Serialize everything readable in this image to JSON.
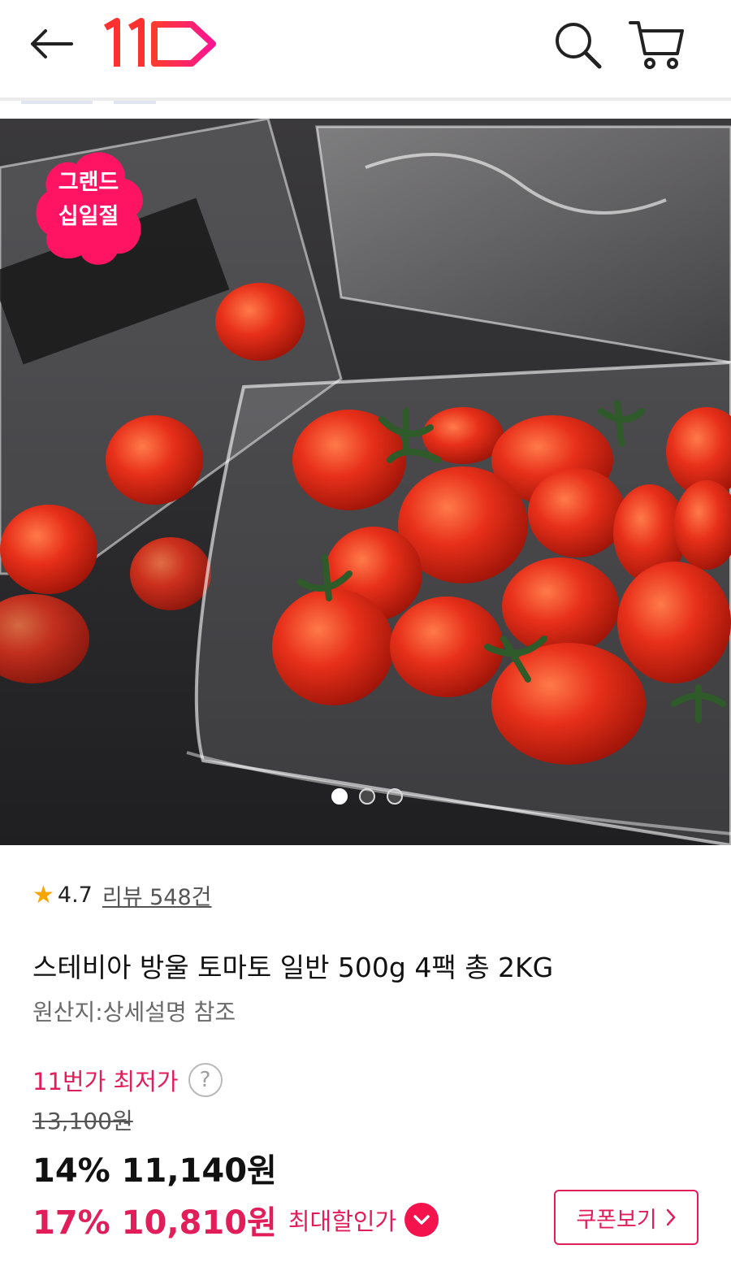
{
  "header": {
    "logo_text": "11",
    "icons": {
      "back": "back-arrow-icon",
      "search": "search-icon",
      "cart": "cart-icon"
    },
    "brand_color": "#ff1f4f"
  },
  "hero": {
    "badge_line1": "그랜드",
    "badge_line2": "십일절",
    "image_description": "product-photo-cherry-tomatoes-in-clear-plastic-packs",
    "slide_count": 3,
    "active_slide": 1
  },
  "product": {
    "rating": "4.7",
    "reviews": "리뷰 548건",
    "title": "스테비아 방울 토마토 일반 500g 4팩 총 2KG",
    "origin": "원산지:상세설명 참조"
  },
  "pricing": {
    "lowest_label": "11번가 최저가",
    "help_symbol": "?",
    "original_price": "13,100원",
    "discount_price": "14% 11,140원",
    "max_discount_price": "17% 10,810원",
    "max_discount_label": "최대할인가",
    "coupon_label": "쿠폰보기",
    "accent_color": "#e11e5a"
  }
}
